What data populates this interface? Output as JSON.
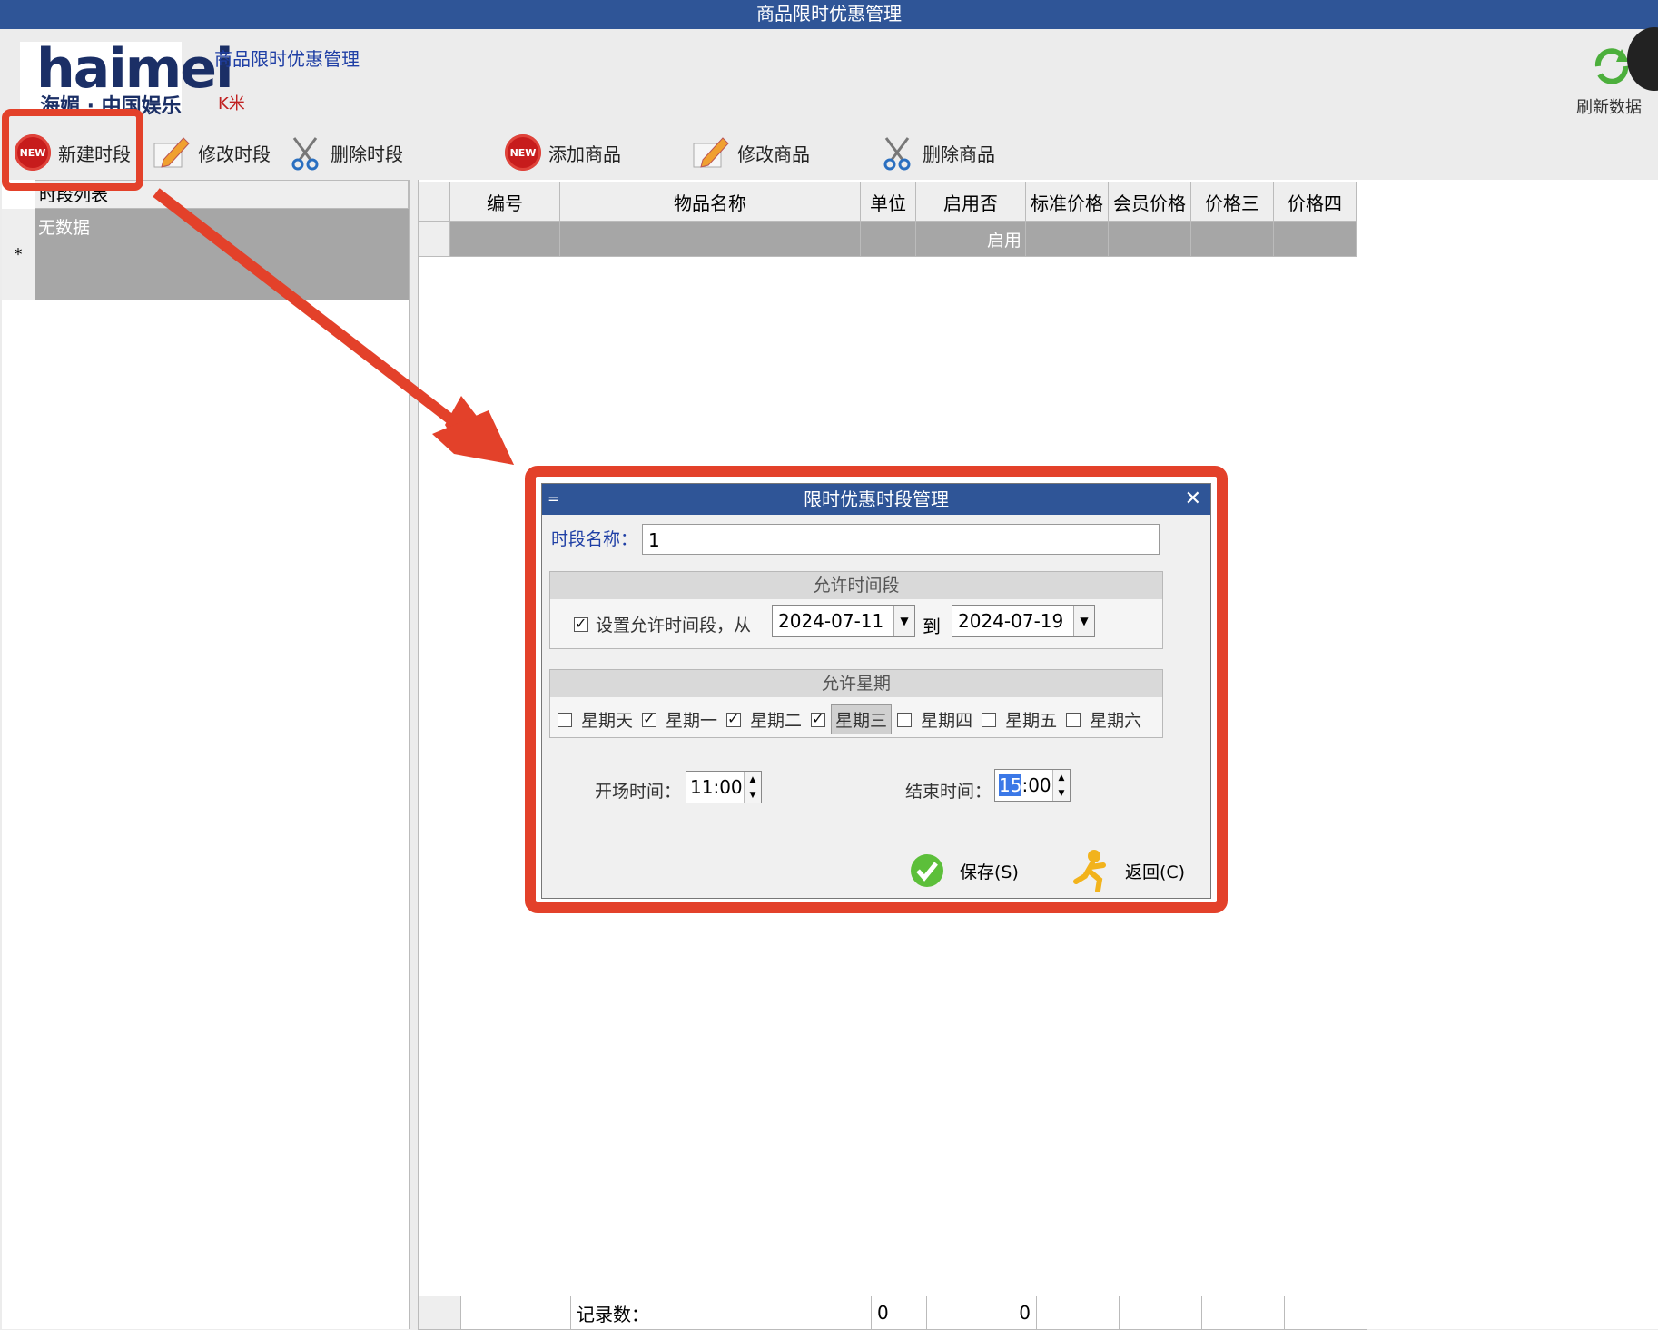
{
  "window": {
    "title": "商品限时优惠管理"
  },
  "header": {
    "title": "商品限时优惠管理",
    "user": "K米",
    "logo_text": "haimei",
    "logo_sub": "海媚 · 中国娱乐"
  },
  "toolbar": {
    "new_period": "新建时段",
    "edit_period": "修改时段",
    "delete_period": "删除时段",
    "add_product": "添加商品",
    "edit_product": "修改商品",
    "delete_product": "删除商品",
    "refresh": "刷新数据"
  },
  "left_list": {
    "header": "时段列表",
    "empty_text": "无数据",
    "row_marker": "*"
  },
  "grid": {
    "columns": [
      "编号",
      "物品名称",
      "单位",
      "启用否",
      "标准价格",
      "会员价格",
      "价格三",
      "价格四"
    ],
    "row": [
      "",
      "",
      "",
      "启用",
      "",
      "",
      "",
      ""
    ]
  },
  "footer": {
    "record_label": "记录数：",
    "count1": "0",
    "count2": "0"
  },
  "dialog": {
    "title": "限时优惠时段管理",
    "sysmenu": "=",
    "close": "✕",
    "name_label": "时段名称：",
    "name_value": "1",
    "period_group": "允许时间段",
    "set_period_label": "设置允许时间段，从",
    "set_period_checked": true,
    "date_from": "2024-07-11",
    "to_label": "到",
    "date_to": "2024-07-19",
    "week_group": "允许星期",
    "weekdays": [
      {
        "label": "星期天",
        "checked": false
      },
      {
        "label": "星期一",
        "checked": true
      },
      {
        "label": "星期二",
        "checked": true
      },
      {
        "label": "星期三",
        "checked": true
      },
      {
        "label": "星期四",
        "checked": false
      },
      {
        "label": "星期五",
        "checked": false
      },
      {
        "label": "星期六",
        "checked": false
      }
    ],
    "start_label": "开场时间：",
    "start_time": "11:00",
    "end_label": "结束时间：",
    "end_time_hour": "15",
    "end_time_rest": ":00",
    "save": "保存(S)",
    "back": "返回(C)"
  },
  "colors": {
    "titlebar": "#2f5597",
    "highlight": "#e3412a",
    "grid_row": "#a6a6a6"
  }
}
